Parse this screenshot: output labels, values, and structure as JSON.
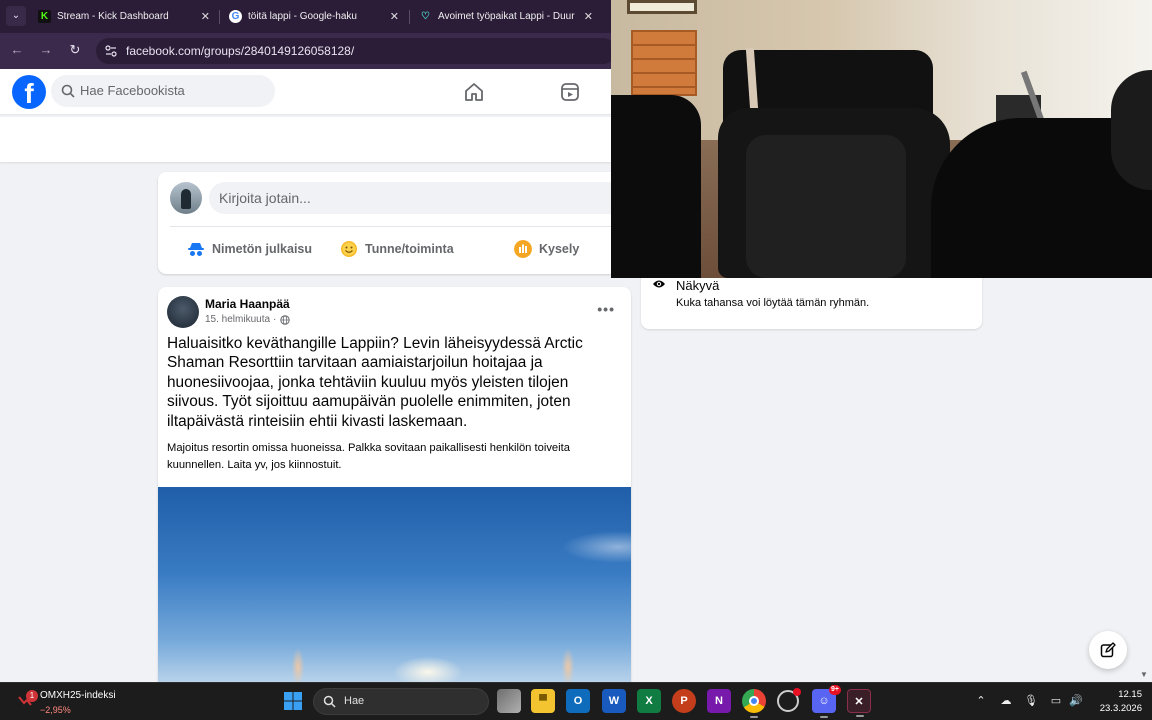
{
  "browser": {
    "tabs": [
      {
        "title": "Stream - Kick Dashboard",
        "icon": "kick-icon",
        "active": false
      },
      {
        "title": "töitä lappi - Google-haku",
        "icon": "google-icon",
        "active": false
      },
      {
        "title": "Avoimet työpaikat Lappi - Duur",
        "icon": "duunitori-icon",
        "active": true
      }
    ],
    "url": "facebook.com/groups/2840149126058128/"
  },
  "facebook": {
    "search_placeholder": "Hae Facebookista",
    "composer": {
      "placeholder": "Kirjoita jotain...",
      "actions": [
        {
          "label": "Nimetön julkaisu",
          "icon": "anonymous-icon"
        },
        {
          "label": "Tunne/toiminta",
          "icon": "smiley-icon"
        },
        {
          "label": "Kysely",
          "icon": "poll-icon"
        }
      ]
    },
    "post": {
      "author": "Maria Haanpää",
      "date": "15. helmikuuta",
      "more": "•••",
      "headline": "Haluaisitko keväthangille Lappiin? Levin läheisyydessä Arctic Shaman Resorttiin tarvitaan aamiaistarjoilun hoitajaa ja huonesiivoojaa, jonka tehtäviin kuuluu myös yleisten tilojen siivous. Työt sijoittuu aamupäivän puolelle enimmiten, joten iltapäivästä rinteisiin ehtii kivasti laskemaan.",
      "body": "Majoitus resortin omissa huoneissa. Palkka sovitaan paikallisesti henkilön toiveita kuunnellen. Laita yv, jos kiinnostuit."
    },
    "about": {
      "title": "Näkyvä",
      "desc": "Kuka tahansa voi löytää tämän ryhmän."
    }
  },
  "taskbar": {
    "widget": {
      "name": "OMXH25-indeksi",
      "value": "−2,95%",
      "badge": "1"
    },
    "search": "Hae",
    "discord_badge": "9+",
    "time": "12.15",
    "date": "23.3.2026"
  },
  "colors": {
    "facebook_blue": "#0866ff",
    "browser_chrome": "#3b2a4c",
    "taskbar": "#1c1c1c"
  }
}
